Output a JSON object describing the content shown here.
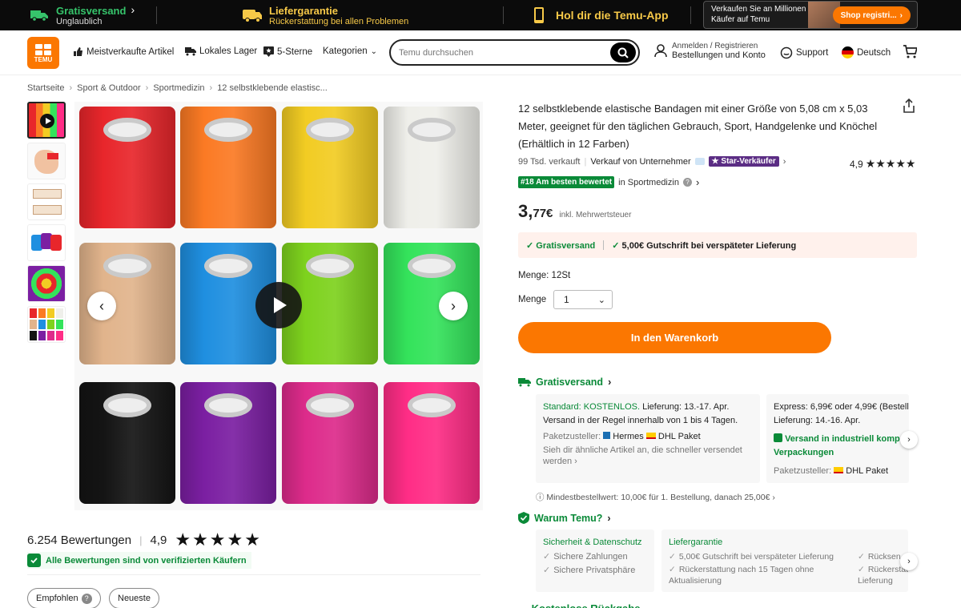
{
  "topbar": {
    "free_shipping_title": "Gratisversand",
    "free_shipping_sub": "Unglaublich",
    "guarantee_title": "Liefergarantie",
    "guarantee_sub": "Rückerstattung bei allen Problemen",
    "app_label": "Hol dir die Temu-App",
    "promo_text": "Verkaufen Sie an Millionen Käufer auf Temu",
    "promo_button": "Shop registri..."
  },
  "header": {
    "logo_text": "TEMU",
    "nav": [
      "Meistverkaufte Artikel",
      "Lokales Lager",
      "5-Sterne",
      "Kategorien"
    ],
    "search_placeholder": "Temu durchsuchen",
    "account_line1": "Anmelden / Registrieren",
    "account_line2": "Bestellungen und Konto",
    "support": "Support",
    "language": "Deutsch"
  },
  "breadcrumb": [
    "Startseite",
    "Sport & Outdoor",
    "Sportmedizin",
    "12 selbstklebende elastisc..."
  ],
  "gallery": {
    "roll_colors": [
      "#e8262b",
      "#fb7a24",
      "#f2cc23",
      "#efefea",
      "#e1b48c",
      "#1f8fe0",
      "#7ed21e",
      "#34e35b",
      "#141414",
      "#7b1fa2",
      "#dd2b8b",
      "#ff2d86"
    ]
  },
  "product": {
    "title": "12 selbstklebende elastische Bandagen mit einer Größe von 5,08 cm x 5,03 Meter, geeignet für den täglichen Gebrauch, Sport, Handgelenke und Knöchel (Erhältlich in 12 Farben)",
    "sold": "99 Tsd. verkauft",
    "seller": "Verkauf von Unternehmer",
    "star_seller": "Star-Verkäufer",
    "rating": "4,9",
    "best_badge": "#18 Am besten bewertet",
    "best_category": "in Sportmedizin",
    "price_int": "3,",
    "price_dec": "77€",
    "price_note": "inkl. Mehrwertsteuer",
    "ship_tag1": "Gratisversand",
    "ship_tag2": "5,00€ Gutschrift bei verspäteter Lieferung",
    "menge_label": "Menge: 12St",
    "qty_label": "Menge",
    "qty_value": "1",
    "cart_button": "In den Warenkorb"
  },
  "shipping": {
    "heading": "Gratisversand",
    "standard_title": "Standard: KOSTENLOS.",
    "standard_line": "Lieferung: 13.-17. Apr.",
    "standard_line2": "Versand in der Regel innerhalb von 1 bis 4 Tagen.",
    "carrier_label": "Paketzusteller:",
    "carrier1": "Hermes",
    "carrier2": "DHL Paket",
    "similar": "Sieh dir ähnliche Artikel an, die schneller versendet werden",
    "express_line1": "Express: 6,99€ oder 4,99€ (Bestell",
    "express_line2": "Lieferung: 14.-16. Apr.",
    "eco": "Versand in industriell komp",
    "eco2": "Verpackungen",
    "carrier_express": "DHL Paket",
    "min_order": "Mindestbestellwert: 10,00€ für 1. Bestellung, danach 25,00€"
  },
  "why": {
    "heading": "Warum Temu?",
    "c1_title": "Sicherheit & Datenschutz",
    "c1_items": [
      "Sichere Zahlungen",
      "Sichere Privatsphäre"
    ],
    "c2_title": "Liefergarantie",
    "c2_items": [
      "5,00€ Gutschrift bei verspäteter Lieferung",
      "Rückerstattung nach 15 Tagen ohne Aktualisierung"
    ],
    "c3_items": [
      "Rücksen",
      "Rückerstat Lieferung"
    ]
  },
  "reviews": {
    "count": "6.254 Bewertungen",
    "rating": "4,9",
    "verified": "Alle Bewertungen sind von verifizierten Käufern",
    "filters": [
      "Empfohlen",
      "Neueste"
    ]
  },
  "colors": {
    "accent": "#fb7701",
    "green": "#0a8a38",
    "star_seller": "#5b2d84"
  }
}
